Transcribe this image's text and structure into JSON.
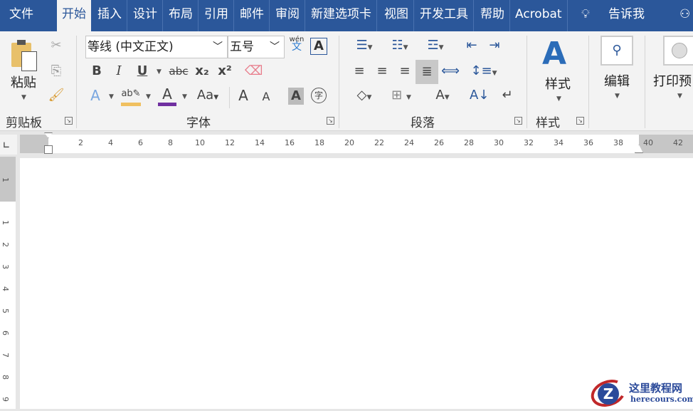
{
  "tabs": [
    "文件",
    "开始",
    "插入",
    "设计",
    "布局",
    "引用",
    "邮件",
    "审阅",
    "新建选项卡",
    "视图",
    "开发工具",
    "帮助",
    "Acrobat"
  ],
  "tell_me": "告诉我",
  "clipboard": {
    "paste": "粘贴",
    "group": "剪贴板"
  },
  "font": {
    "name": "等线 (中文正文)",
    "size": "五号",
    "group": "字体",
    "phonetic_top": "wén",
    "phonetic_bottom": "文",
    "bold": "B",
    "italic": "I",
    "underline": "U",
    "strike": "abc",
    "sub": "x₂",
    "sup": "x²",
    "case": "Aa",
    "grow": "A",
    "shrink": "A",
    "shade": "A",
    "enclose": "字",
    "border_char": "A"
  },
  "paragraph": {
    "group": "段落"
  },
  "styles": {
    "label": "样式",
    "group": "样式"
  },
  "editing": {
    "label": "编辑"
  },
  "print": {
    "label": "打印预"
  },
  "ruler": {
    "h": [
      "2",
      "4",
      "6",
      "8",
      "10",
      "12",
      "14",
      "16",
      "18",
      "20",
      "22",
      "24",
      "26",
      "28",
      "30",
      "32",
      "34",
      "36",
      "38",
      "40",
      "42"
    ],
    "v": [
      "1",
      "2",
      "3",
      "4",
      "5",
      "6",
      "7",
      "8",
      "9"
    ],
    "v_top": "1"
  },
  "watermark": {
    "title": "这里教程网",
    "url": "herecours.com"
  },
  "colors": {
    "brand": "#2b579a",
    "font_color": "#7030a0",
    "highlight": "#f0c060"
  }
}
